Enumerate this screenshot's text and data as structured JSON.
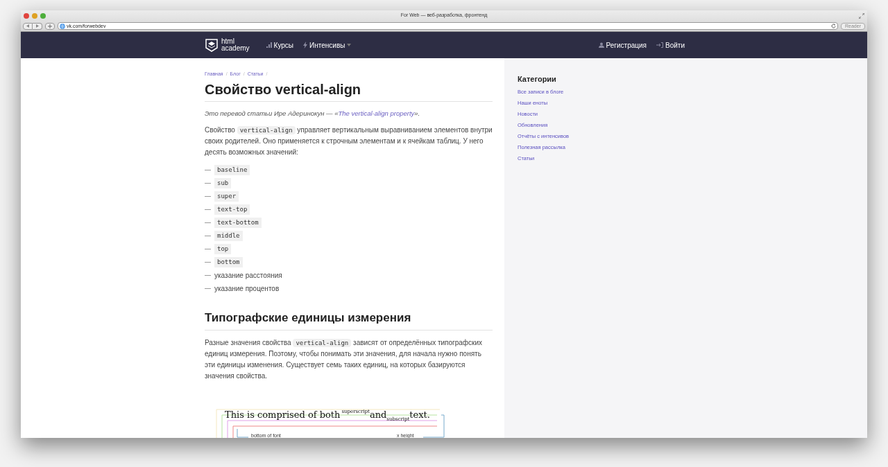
{
  "window": {
    "title": "For Web — веб-разработка, фронтенд",
    "url": "vk.com/forwebdev",
    "reader": "Reader"
  },
  "nav": {
    "logo": [
      "html",
      "academy"
    ],
    "left": [
      {
        "label": "Курсы",
        "kind": "chart",
        "dropdown": false
      },
      {
        "label": "Интенсивы",
        "kind": "bolt",
        "dropdown": true
      }
    ],
    "right": [
      {
        "label": "Регистрация",
        "kind": "user"
      },
      {
        "label": "Войти",
        "kind": "login"
      }
    ]
  },
  "breadcrumbs": [
    {
      "label": "Главная",
      "separator": "/"
    },
    {
      "label": "Блог",
      "separator": "/"
    },
    {
      "label": "Статьи",
      "separator": "/"
    }
  ],
  "title": "Свойство vertical-align",
  "intro": {
    "text": "Это перевод статьи Ире Адеринокун — «",
    "link": "The vertical-align property",
    "after": "»."
  },
  "paragraph1": [
    {
      "text": "Свойство "
    },
    {
      "code": "vertical-align"
    },
    {
      "text": " управляет вертикальным выравниванием элементов внутри своих родителей. Оно применяется к строчным элементам и к ячейкам таблиц. У него десять возможных значений:"
    }
  ],
  "values": [
    {
      "bullet": "—",
      "kind": "code",
      "text": "baseline"
    },
    {
      "bullet": "—",
      "kind": "code",
      "text": "sub"
    },
    {
      "bullet": "—",
      "kind": "code",
      "text": "super"
    },
    {
      "bullet": "—",
      "kind": "code",
      "text": "text-top"
    },
    {
      "bullet": "—",
      "kind": "code",
      "text": "text-bottom"
    },
    {
      "bullet": "—",
      "kind": "code",
      "text": "middle"
    },
    {
      "bullet": "—",
      "kind": "code",
      "text": "top"
    },
    {
      "bullet": "—",
      "kind": "code",
      "text": "bottom"
    },
    {
      "bullet": "—",
      "kind": "text",
      "text": "указание расстояния"
    },
    {
      "bullet": "—",
      "kind": "text",
      "text": "указание процентов"
    }
  ],
  "heading2": "Типографские единицы измерения",
  "paragraph2": [
    {
      "text": "Разные значения свойства "
    },
    {
      "code": "vertical-align"
    },
    {
      "text": " зависят от определённых типографских единиц измерения. Поэтому, чтобы понимать эти значения, для начала нужно понять эти единицы изменения. Существует семь таких единиц, на которых базируются значения свойства."
    }
  ],
  "figure": {
    "sentence": [
      "This is comprised of both",
      "superscript",
      "and",
      "subscript",
      "text."
    ],
    "labels": [
      "bottom of font",
      "x height"
    ]
  },
  "sidebar": {
    "title": "Категории",
    "items": [
      "Все записи в блоге",
      "Наши еноты",
      "Новости",
      "Обновления",
      "Отчёты с интенсивов",
      "Полезная рассылка",
      "Статьи"
    ]
  }
}
